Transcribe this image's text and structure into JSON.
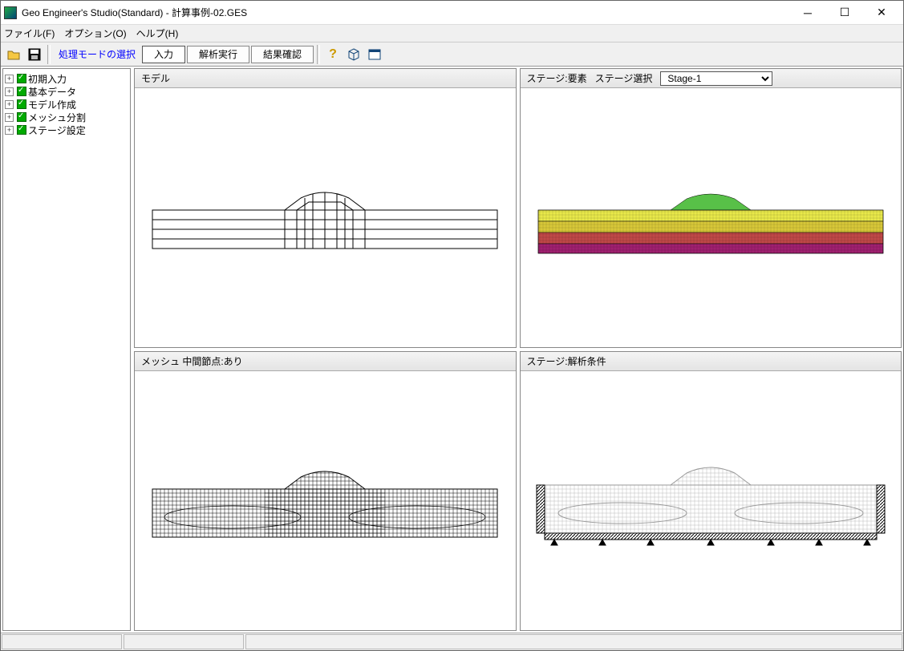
{
  "window": {
    "title": "Geo Engineer's Studio(Standard) - 計算事例-02.GES"
  },
  "menubar": {
    "file": "ファイル(F)",
    "option": "オプション(O)",
    "help": "ヘルプ(H)"
  },
  "toolbar": {
    "mode_label": "処理モードの選択",
    "input": "入力",
    "analyze": "解析実行",
    "result": "結果確認"
  },
  "tree": {
    "items": [
      {
        "label": "初期入力"
      },
      {
        "label": "基本データ"
      },
      {
        "label": "モデル作成"
      },
      {
        "label": "メッシュ分割"
      },
      {
        "label": "ステージ設定"
      }
    ]
  },
  "panels": {
    "topleft": {
      "title": "モデル"
    },
    "topright": {
      "title": "ステージ:要素",
      "select_label": "ステージ選択",
      "stage_value": "Stage-1"
    },
    "bottomleft": {
      "title": "メッシュ 中間節点:あり"
    },
    "bottomright": {
      "title": "ステージ:解析条件"
    }
  },
  "colors": {
    "layer1": "#e8e84a",
    "layer2": "#d8c838",
    "layer3": "#c04848",
    "layer4": "#a02070",
    "embank": "#58c048"
  }
}
